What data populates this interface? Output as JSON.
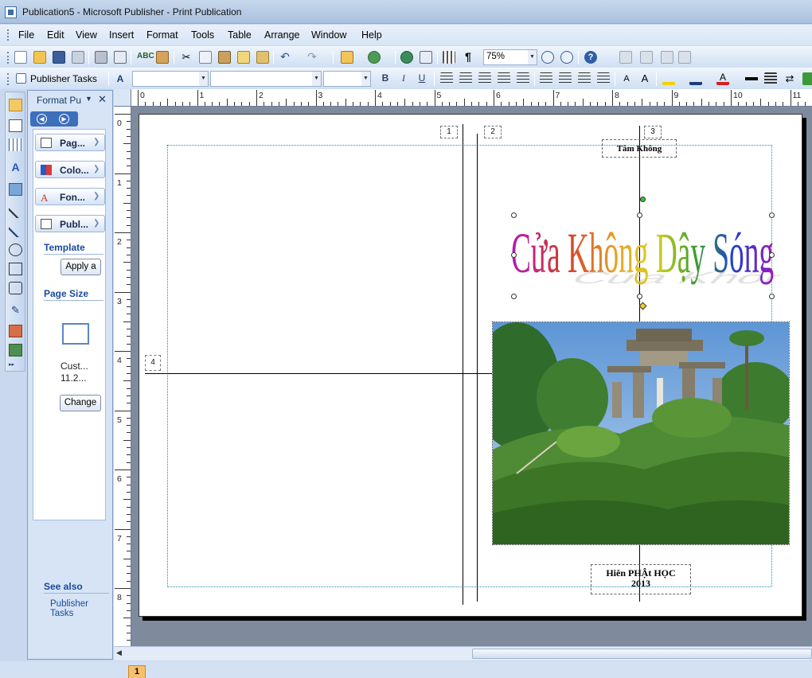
{
  "window": {
    "title": "Publication5 - Microsoft Publisher - Print Publication"
  },
  "menu": {
    "items": [
      "File",
      "Edit",
      "View",
      "Insert",
      "Format",
      "Tools",
      "Table",
      "Arrange",
      "Window",
      "Help"
    ]
  },
  "standard_toolbar": {
    "zoom": "75%",
    "icons": [
      "new-icon",
      "open-icon",
      "save-icon",
      "permission-icon",
      "print-icon",
      "print-preview-icon",
      "spelling-icon",
      "research-icon",
      "cut-icon",
      "copy-icon",
      "paste-icon",
      "format-painter-icon",
      "undo-icon",
      "redo-icon",
      "bring-forward-icon",
      "rotate-icon",
      "insert-hyperlink-icon",
      "preview-icon",
      "columns-icon",
      "paragraph-mark-icon",
      "zoom-out-icon",
      "zoom-in-icon",
      "help-icon"
    ]
  },
  "formatting_toolbar": {
    "publisher_tasks_label": "Publisher Tasks",
    "style_value": "",
    "font_value": "",
    "size_value": "",
    "buttons": [
      "B",
      "I",
      "U"
    ]
  },
  "task_pane": {
    "title": "Format Pu",
    "sections": [
      {
        "label": "Pag...",
        "icon": "page-options-icon",
        "expanded": false
      },
      {
        "label": "Colo...",
        "icon": "color-schemes-icon",
        "expanded": false
      },
      {
        "label": "Fon...",
        "icon": "font-schemes-icon",
        "expanded": false
      },
      {
        "label": "Publ...",
        "icon": "publication-options-icon",
        "expanded": true
      }
    ],
    "template_heading": "Template",
    "apply_button": "Apply a",
    "page_size_heading": "Page Size",
    "page_size_name": "Cust...",
    "page_size_value": "11.2...",
    "change_button": "Change",
    "see_also_heading": "See also",
    "see_also_link": "Publisher Tasks"
  },
  "rulers": {
    "horizontal": [
      "0",
      "1",
      "2",
      "3",
      "4",
      "5",
      "6",
      "7",
      "8",
      "9",
      "10",
      "11"
    ],
    "vertical": [
      "0",
      "1",
      "2",
      "3",
      "4",
      "5",
      "6",
      "7",
      "8"
    ]
  },
  "document": {
    "guide_numbers": [
      "1",
      "2",
      "3",
      "4"
    ],
    "header_text": "Tâm Không",
    "wordart_text": "Cửa Không Dậy Sóng",
    "footer_line1": "Hiên PHẬt HỌC",
    "footer_line2": "2013",
    "photo_subject": "stone gate on a hill among trees"
  },
  "status": {
    "page_tab": "1"
  },
  "colors": {
    "accent": "#3d6fbd",
    "margin_guide": "#1a8fb8",
    "page_tab": "#f7c16b"
  }
}
